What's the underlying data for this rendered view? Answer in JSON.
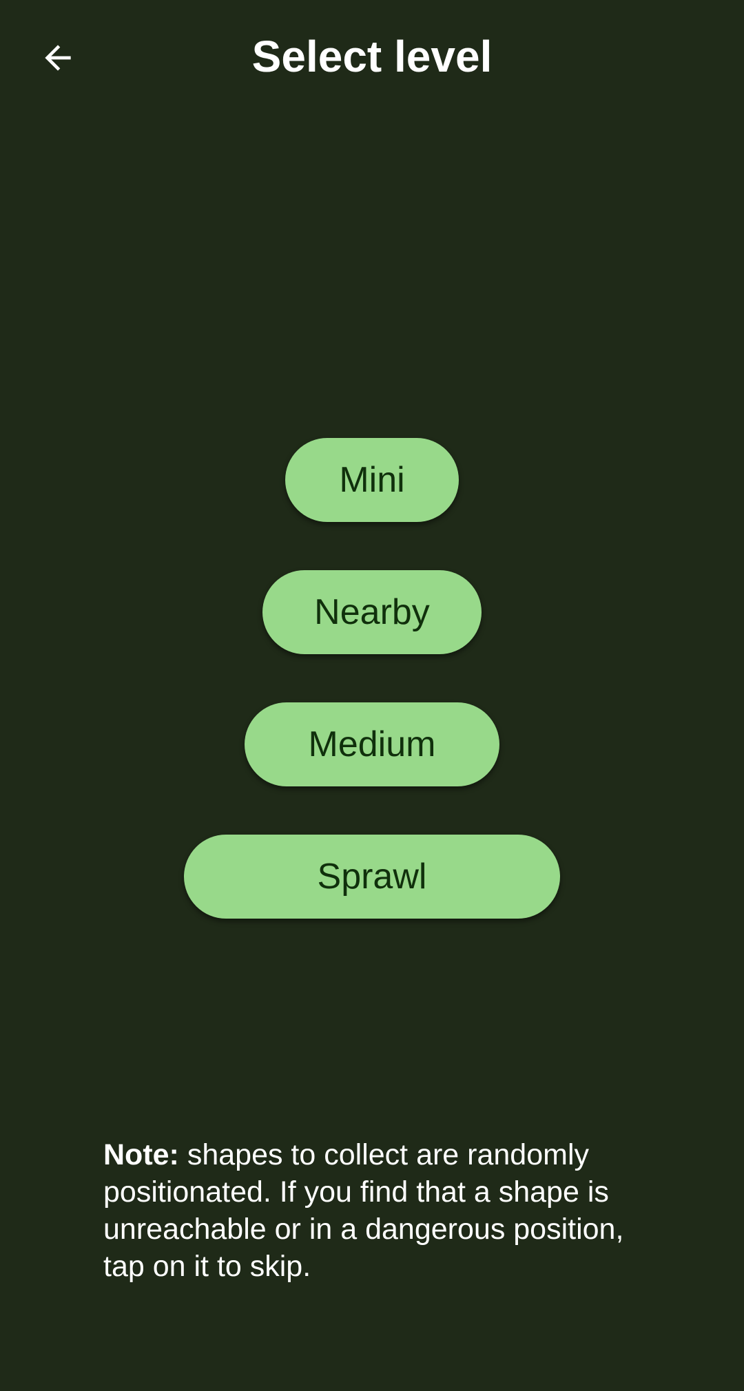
{
  "header": {
    "title": "Select level",
    "back_icon": "arrow-left-icon"
  },
  "levels": [
    {
      "label": "Mini"
    },
    {
      "label": "Nearby"
    },
    {
      "label": "Medium"
    },
    {
      "label": "Sprawl"
    }
  ],
  "note": {
    "label": "Note:",
    "text": " shapes to collect are randomly positionated. If you find that a shape is unreachable or in a dangerous position, tap on it to skip."
  },
  "colors": {
    "background": "#1f2a18",
    "button": "#98d98a",
    "button_text": "#10300c",
    "text": "#ffffff"
  }
}
